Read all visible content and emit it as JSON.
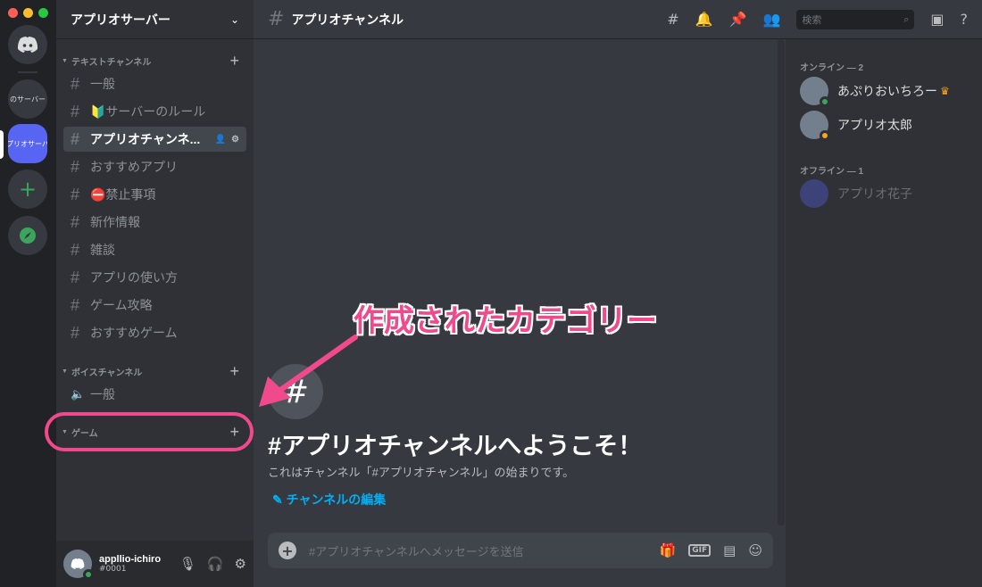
{
  "window": {
    "traffic_lights": [
      "#ff5f57",
      "#febc2e",
      "#28c840"
    ]
  },
  "servers": {
    "items": [
      {
        "label": "のサーバー"
      },
      {
        "label": "プリオサーバ"
      }
    ],
    "add_icon": "plus-icon",
    "explore_icon": "compass-icon"
  },
  "sidebar": {
    "server_name": "アプリオサーバー",
    "text_category": "テキストチャンネル",
    "text_channels": [
      "一般",
      "🔰サーバーのルール",
      "アプリオチャンネ...",
      "おすすめアプリ",
      "⛔禁止事項",
      "新作情報",
      "雑談",
      "アプリの使い方",
      "ゲーム攻略",
      "おすすめゲーム"
    ],
    "voice_category": "ボイスチャンネル",
    "voice_channels": [
      "一般"
    ],
    "game_category": "ゲーム"
  },
  "user": {
    "name": "appllio-ichiro",
    "tag": "#0001"
  },
  "topbar": {
    "channel": "アプリオチャンネル",
    "search_placeholder": "検索"
  },
  "chat": {
    "welcome_title": "#アプリオチャンネルへようこそ！",
    "welcome_sub": "これはチャンネル「#アプリオチャンネル」の始まりです。",
    "edit_link": "チャンネルの編集",
    "message_placeholder": "#アプリオチャンネルへメッセージを送信"
  },
  "members": {
    "online_header": "オンライン — 2",
    "online": [
      "あぷりおいちろー",
      "アプリオ太郎"
    ],
    "offline_header": "オフライン — 1",
    "offline": [
      "アプリオ花子"
    ]
  },
  "annotation": {
    "label": "作成されたカテゴリー",
    "color": "#f04a8c"
  },
  "colors": {
    "accent": "#5865f2",
    "online": "#3ba55d",
    "link": "#00aff4"
  }
}
